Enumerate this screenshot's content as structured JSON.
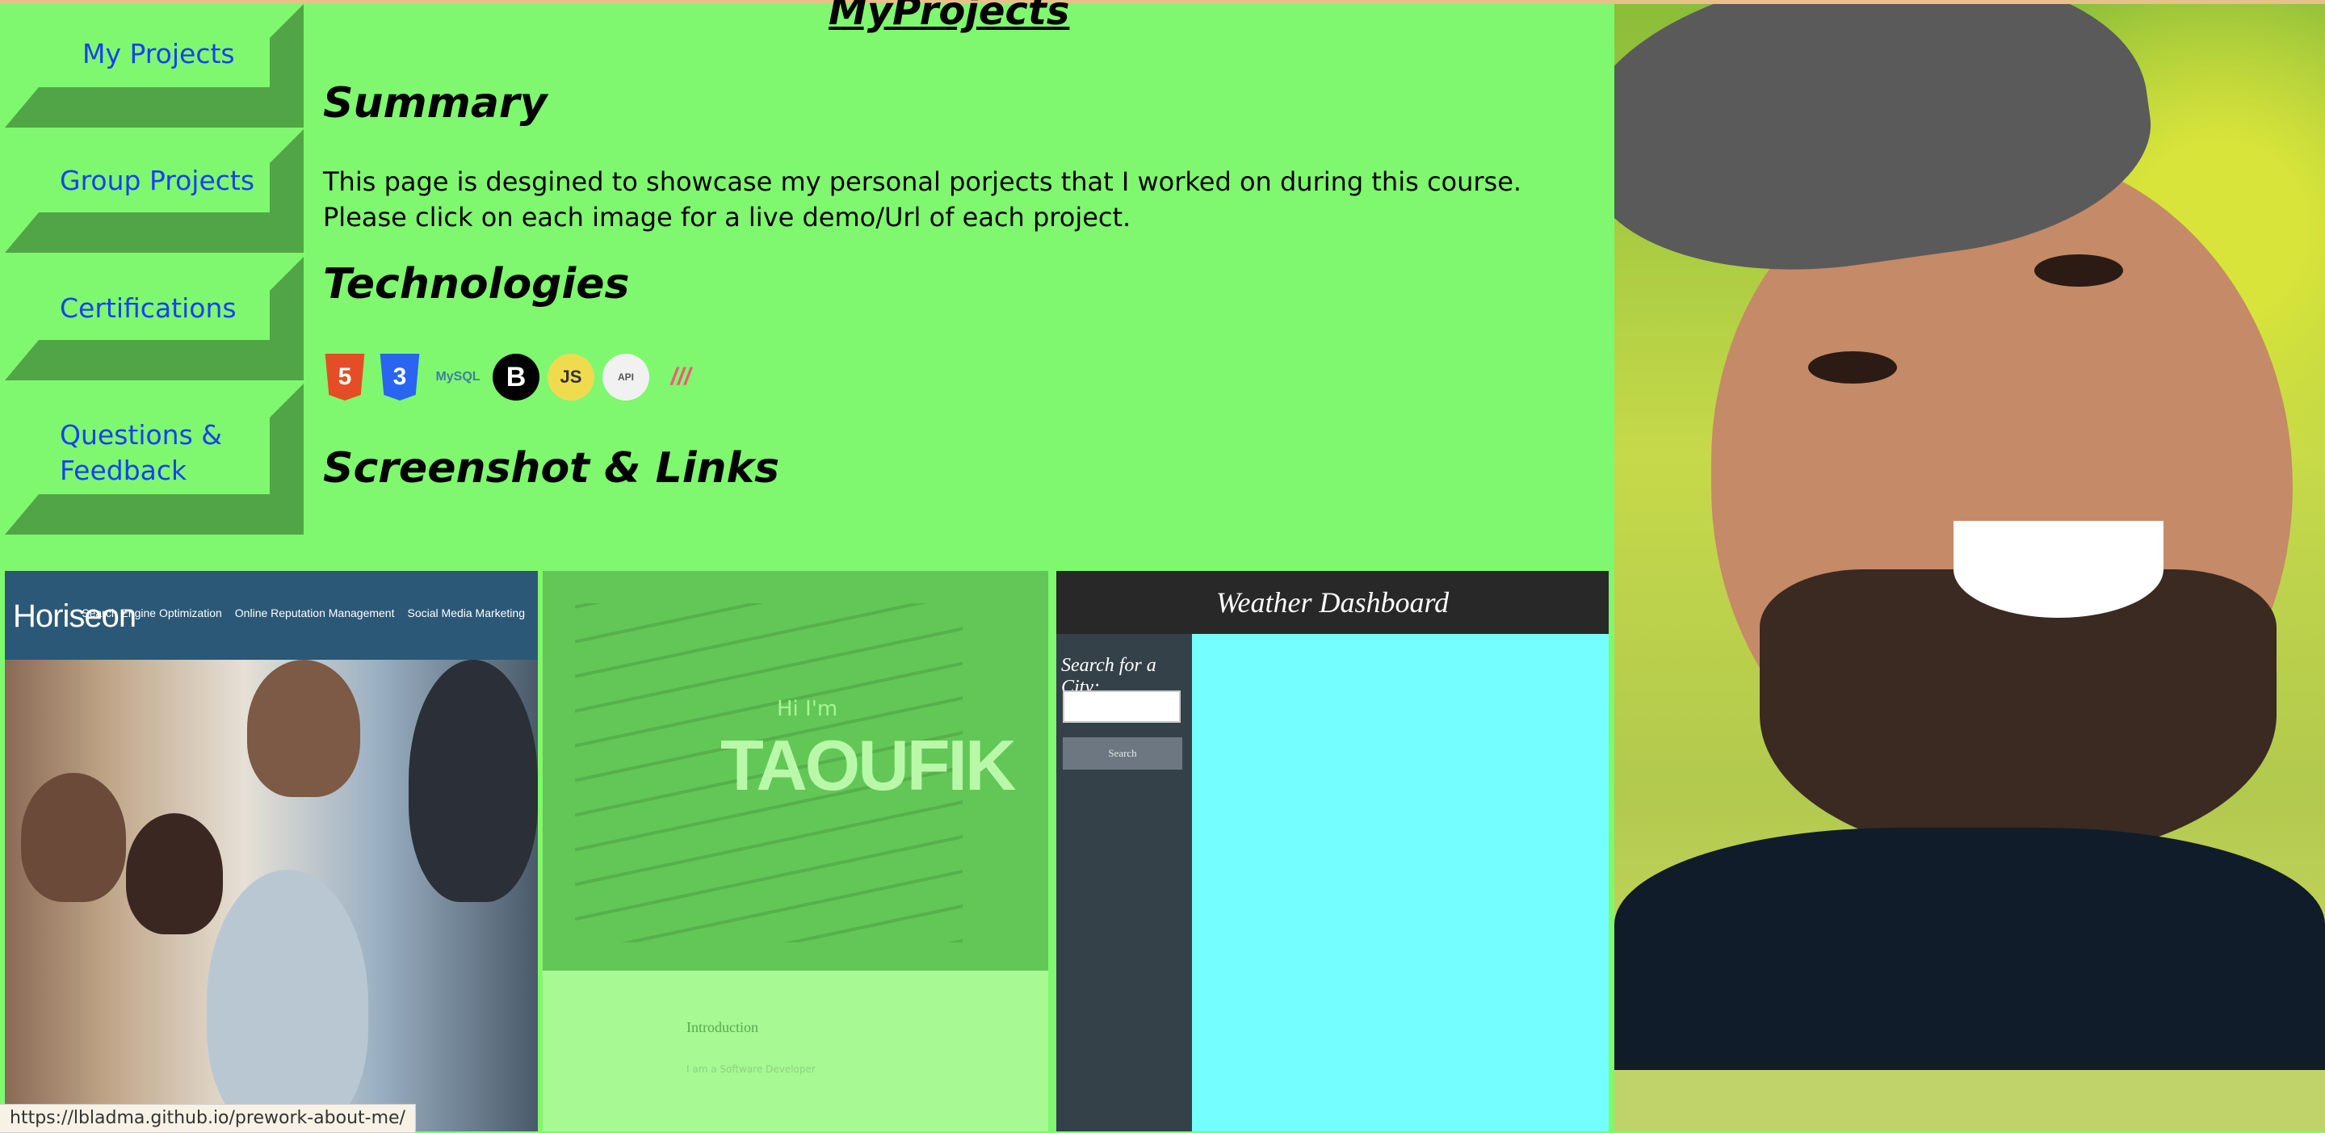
{
  "nav": {
    "items": [
      {
        "label": "My Projects"
      },
      {
        "label": "Group Projects"
      },
      {
        "label": "Certifications"
      },
      {
        "label": "Questions & Feedback"
      }
    ]
  },
  "header": {
    "title": "MyProjects"
  },
  "summary": {
    "heading": "Summary",
    "text": "This page is desgined to showcase my personal porjects that I worked on during this course. Please click on each image for a live demo/Url of each project."
  },
  "technologies": {
    "heading": "Technologies",
    "icons": [
      {
        "name": "html5-icon",
        "glyph": "5"
      },
      {
        "name": "css3-icon",
        "glyph": "3"
      },
      {
        "name": "mysql-icon",
        "glyph": "MySQL"
      },
      {
        "name": "bootstrap-icon",
        "glyph": "B"
      },
      {
        "name": "javascript-icon",
        "glyph": "JS"
      },
      {
        "name": "api-icon",
        "glyph": "API"
      },
      {
        "name": "stackbit-icon",
        "glyph": "///"
      }
    ]
  },
  "screenshots": {
    "heading": "Screenshot & Links",
    "card1": {
      "logo": "Horiseon",
      "links": [
        "Search Engine Optimization",
        "Online Reputation Management",
        "Social Media Marketing"
      ]
    },
    "card2": {
      "greeting": "Hi I'm",
      "name": "TAOUFIK",
      "intro": "Introduction",
      "subtext": "I am a Software Developer"
    },
    "card3": {
      "title": "Weather Dashboard",
      "search_label": "Search for a City:",
      "search_button": "Search"
    }
  },
  "status": {
    "url": "https://lbladma.github.io/prework-about-me/"
  }
}
